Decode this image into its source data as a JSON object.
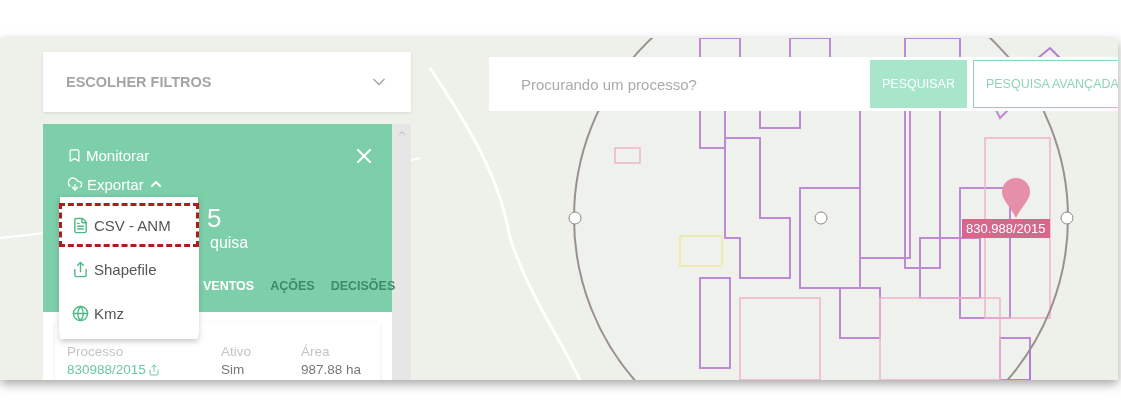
{
  "filters": {
    "label": "ESCOLHER FILTROS",
    "expanded": false
  },
  "search": {
    "placeholder": "Procurando um processo?",
    "buttons": [
      {
        "label": "PESQUISAR",
        "kind": "primary"
      },
      {
        "label": "PESQUISA AVANÇADA",
        "kind": "outline"
      }
    ]
  },
  "panel": {
    "actions": [
      {
        "label": "Monitorar",
        "kind": "bookmark"
      },
      {
        "label": "Exportar",
        "kind": "export",
        "expanded": true
      }
    ],
    "title": "5",
    "subtitle": "quisa",
    "tabs": [
      {
        "label": "VENTOS",
        "selected": true
      },
      {
        "label": "AÇÕES",
        "selected": false
      },
      {
        "label": "DECISÕES",
        "selected": false
      }
    ],
    "export_menu": [
      {
        "label": "CSV - ANM",
        "kind": "file",
        "highlighted": true
      },
      {
        "label": "Shapefile",
        "kind": "shape",
        "highlighted": false
      },
      {
        "label": "Kmz",
        "kind": "globe",
        "highlighted": false
      }
    ],
    "details": {
      "columns": [
        "Processo",
        "Ativo",
        "Área"
      ],
      "values": [
        "830988/2015",
        "Sim",
        "987.88 ha"
      ]
    }
  },
  "map": {
    "marker_label": "830.988/2015"
  }
}
